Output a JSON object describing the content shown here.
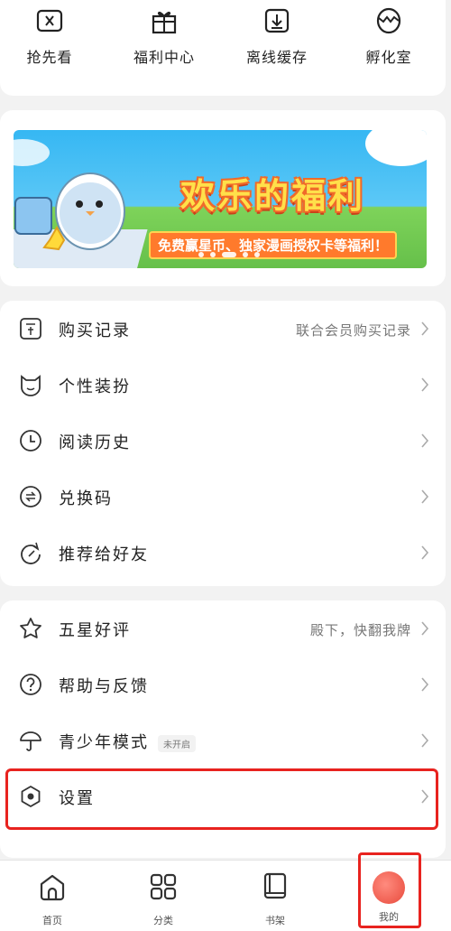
{
  "quick_actions": [
    {
      "label": "抢先看",
      "icon": "ticket-icon"
    },
    {
      "label": "福利中心",
      "icon": "gift-icon"
    },
    {
      "label": "离线缓存",
      "icon": "download-icon"
    },
    {
      "label": "孵化室",
      "icon": "egg-icon"
    }
  ],
  "banner": {
    "title": "欢乐的福利",
    "subtitle": "免费赢星币、独家漫画授权卡等福利！"
  },
  "menu_group_1": [
    {
      "label": "购买记录",
      "right": "联合会员购买记录",
      "icon": "receipt-icon"
    },
    {
      "label": "个性装扮",
      "right": "",
      "icon": "cat-face-icon"
    },
    {
      "label": "阅读历史",
      "right": "",
      "icon": "clock-icon"
    },
    {
      "label": "兑换码",
      "right": "",
      "icon": "exchange-icon"
    },
    {
      "label": "推荐给好友",
      "right": "",
      "icon": "share-icon"
    }
  ],
  "menu_group_2": [
    {
      "label": "五星好评",
      "right": "殿下，快翻我牌",
      "icon": "star-icon"
    },
    {
      "label": "帮助与反馈",
      "right": "",
      "icon": "question-icon"
    },
    {
      "label": "青少年模式",
      "badge": "未开启",
      "right": "",
      "icon": "umbrella-icon"
    },
    {
      "label": "设置",
      "right": "",
      "icon": "settings-icon"
    }
  ],
  "bottom_nav": [
    {
      "label": "首页",
      "icon": "home-icon"
    },
    {
      "label": "分类",
      "icon": "grid-icon"
    },
    {
      "label": "书架",
      "icon": "book-icon"
    },
    {
      "label": "我的",
      "icon": "avatar"
    }
  ],
  "colors": {
    "highlight": "#e8231f",
    "accent_orange": "#ff7a2c"
  }
}
